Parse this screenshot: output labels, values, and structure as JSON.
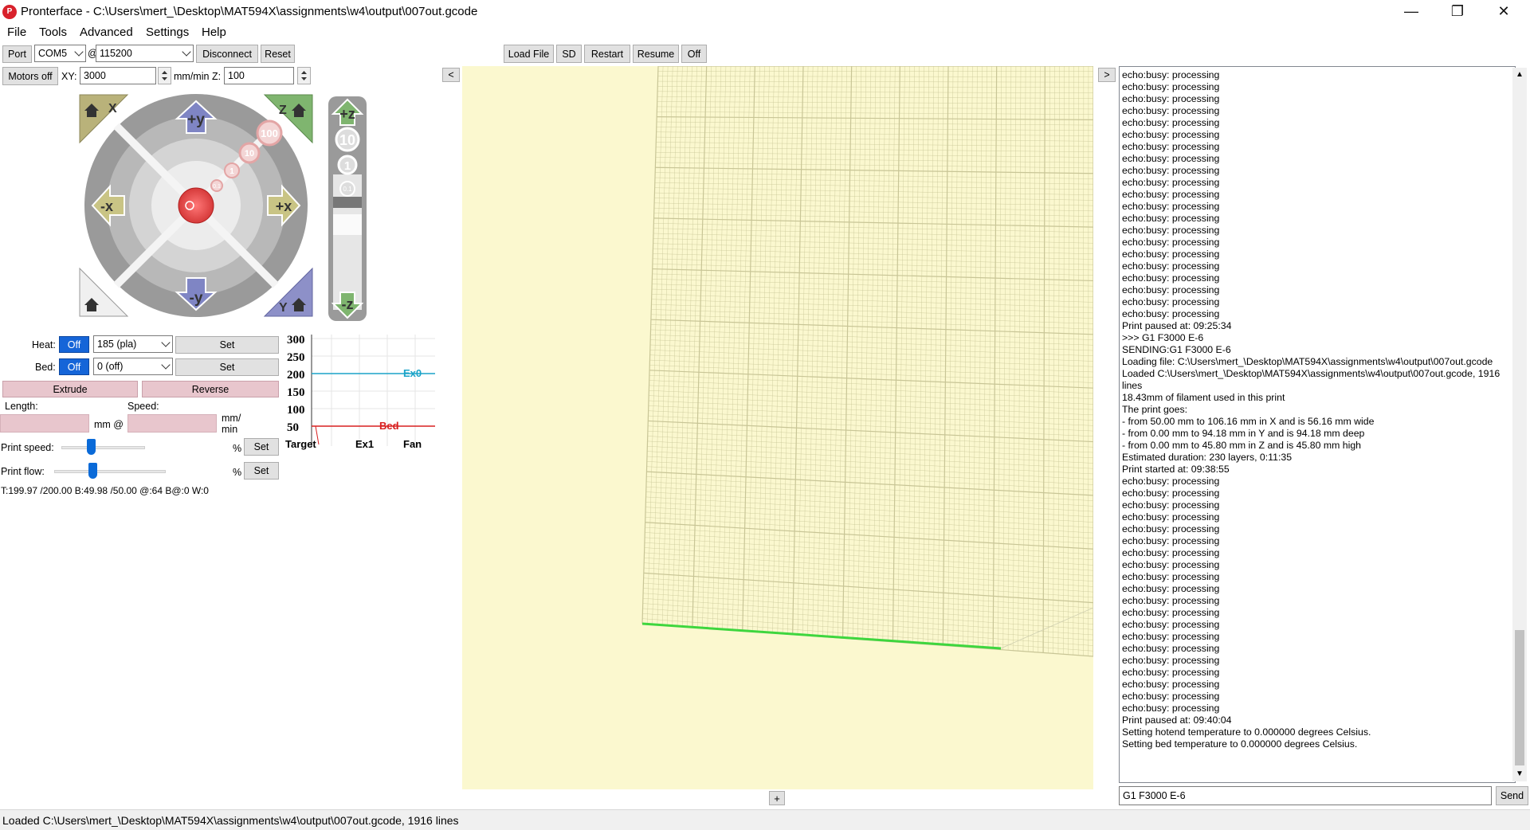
{
  "window": {
    "title": "Pronterface - C:\\Users\\mert_\\Desktop\\MAT594X\\assignments\\w4\\output\\007out.gcode",
    "icon_name": "pronterface-logo-icon",
    "minimize": "—",
    "maximize": "❐",
    "close": "✕"
  },
  "menu": [
    "File",
    "Tools",
    "Advanced",
    "Settings",
    "Help"
  ],
  "toolbar": {
    "port_label": "Port",
    "port_value": "COM5",
    "at": "@",
    "baud_value": "115200",
    "disconnect": "Disconnect",
    "reset": "Reset",
    "load_file": "Load File",
    "sd": "SD",
    "restart": "Restart",
    "resume": "Resume",
    "off": "Off",
    "collapse_left": "<",
    "collapse_right": ">"
  },
  "motion": {
    "motors_off": "Motors off",
    "xy_label": "XY:",
    "xy_value": "3000",
    "units": "mm/min",
    "z_label": "Z:",
    "z_value": "100",
    "home_x": "X",
    "home_z": "Z",
    "home_y": "Y",
    "plus_y": "+y",
    "minus_y": "-y",
    "plus_x": "+x",
    "minus_x": "-x",
    "plus_z": "+z",
    "minus_z": "-z",
    "step_100": "100",
    "step_10": "10",
    "step_1": "1",
    "step_01": "0.1",
    "z_step_10": "10",
    "z_step_1": "1",
    "z_step_01": "0.1"
  },
  "temps": {
    "heat_label": "Heat:",
    "heat_off": "Off",
    "heat_value": "185 (pla)",
    "heat_set": "Set",
    "bed_label": "Bed:",
    "bed_off": "Off",
    "bed_value": "0 (off)",
    "bed_set": "Set"
  },
  "extrude": {
    "extrude": "Extrude",
    "reverse": "Reverse",
    "length_label": "Length:",
    "speed_label": "Speed:",
    "mm_at": "mm @",
    "mm_min": "mm/\nmin",
    "print_speed_label": "Print speed:",
    "print_flow_label": "Print flow:",
    "percent": "%",
    "set": "Set",
    "print_speed_level": 0.35,
    "print_flow_level": 0.34
  },
  "temp_readout": "T:199.97 /200.00 B:49.98 /50.00 @:64 B@:0 W:0",
  "graph": {
    "y_ticks": [
      "300",
      "250",
      "200",
      "150",
      "100",
      "50"
    ],
    "ex0_label": "Ex0",
    "bed_label": "Bed",
    "legend": [
      "Target",
      "Ex1",
      "Fan"
    ],
    "ex0_color": "#1aa3c8",
    "bed_color": "#d82020"
  },
  "console": {
    "lines": [
      "echo:busy: processing",
      "echo:busy: processing",
      "echo:busy: processing",
      "echo:busy: processing",
      "echo:busy: processing",
      "echo:busy: processing",
      "echo:busy: processing",
      "echo:busy: processing",
      "echo:busy: processing",
      "echo:busy: processing",
      "echo:busy: processing",
      "echo:busy: processing",
      "echo:busy: processing",
      "echo:busy: processing",
      "echo:busy: processing",
      "echo:busy: processing",
      "echo:busy: processing",
      "echo:busy: processing",
      "echo:busy: processing",
      "echo:busy: processing",
      "echo:busy: processing",
      "Print paused at: 09:25:34",
      ">>> G1 F3000 E-6",
      "SENDING:G1 F3000 E-6",
      "Loading file: C:\\Users\\mert_\\Desktop\\MAT594X\\assignments\\w4\\output\\007out.gcode",
      "Loaded C:\\Users\\mert_\\Desktop\\MAT594X\\assignments\\w4\\output\\007out.gcode, 1916",
      "lines",
      "18.43mm of filament used in this print",
      "The print goes:",
      "- from 50.00 mm to 106.16 mm in X and is 56.16 mm wide",
      "- from 0.00 mm to 94.18 mm in Y and is 94.18 mm deep",
      "- from 0.00 mm to 45.80 mm in Z and is 45.80 mm high",
      "Estimated duration: 230 layers, 0:11:35",
      "Print started at: 09:38:55",
      "echo:busy: processing",
      "echo:busy: processing",
      "echo:busy: processing",
      "echo:busy: processing",
      "echo:busy: processing",
      "echo:busy: processing",
      "echo:busy: processing",
      "echo:busy: processing",
      "echo:busy: processing",
      "echo:busy: processing",
      "echo:busy: processing",
      "echo:busy: processing",
      "echo:busy: processing",
      "echo:busy: processing",
      "echo:busy: processing",
      "echo:busy: processing",
      "echo:busy: processing",
      "echo:busy: processing",
      "echo:busy: processing",
      "echo:busy: processing",
      "Print paused at: 09:40:04",
      "Setting hotend temperature to 0.000000 degrees Celsius.",
      "Setting bed temperature to 0.000000 degrees Celsius."
    ],
    "input_value": "G1 F3000 E-6",
    "send": "Send"
  },
  "viewport": {
    "add_button": "+",
    "bg_color": "#fbf8cf",
    "grid_color": "#c8c596",
    "print_color": "#3ed63e"
  },
  "status": "Loaded C:\\Users\\mert_\\Desktop\\MAT594X\\assignments\\w4\\output\\007out.gcode, 1916 lines"
}
